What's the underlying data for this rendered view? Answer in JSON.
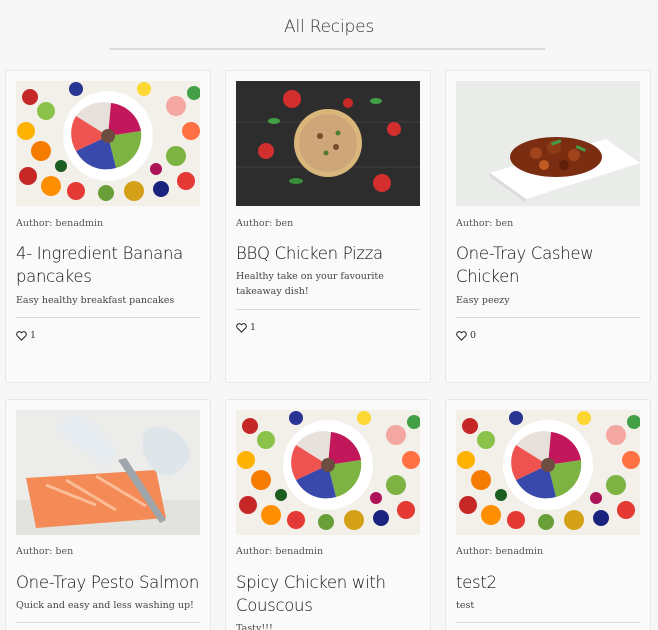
{
  "page": {
    "title": "All Recipes"
  },
  "recipes": [
    {
      "author": "Author: benadmin",
      "title": "4- Ingredient Banana pancakes",
      "description": "Easy healthy breakfast pancakes",
      "likes": "1",
      "image": "fruit-bowl-photo"
    },
    {
      "author": "Author: ben",
      "title": "BBQ Chicken Pizza",
      "description": "Healthy take on your favourite takeaway dish!",
      "likes": "1",
      "image": "pizza-photo"
    },
    {
      "author": "Author: ben",
      "title": "One-Tray Cashew Chicken",
      "description": "Easy peezy",
      "likes": "0",
      "image": "cashew-chicken-photo"
    },
    {
      "author": "Author: ben",
      "title": "One-Tray Pesto Salmon",
      "description": "Quick and easy and less washing up!",
      "likes": "",
      "image": "salmon-photo"
    },
    {
      "author": "Author: benadmin",
      "title": "Spicy Chicken with Couscous",
      "description": "Tasty!!!",
      "likes": "",
      "image": "fruit-bowl-photo"
    },
    {
      "author": "Author: benadmin",
      "title": "test2",
      "description": "test",
      "likes": "",
      "image": "fruit-bowl-photo"
    }
  ],
  "icons": {
    "like": "heart-icon"
  }
}
